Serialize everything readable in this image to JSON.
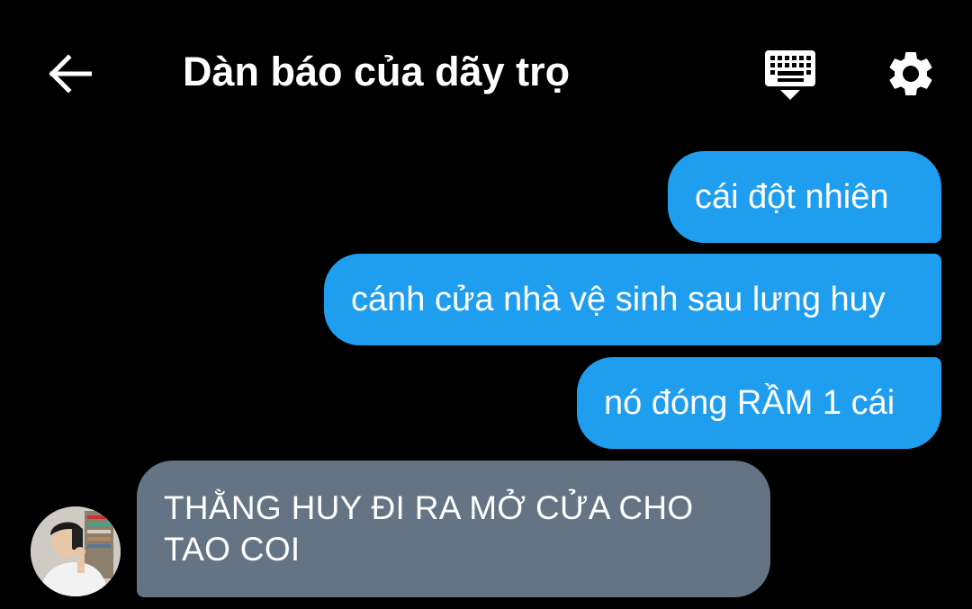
{
  "header": {
    "title": "Dàn báo của dãy trọ",
    "back_icon": "arrow-left-icon",
    "keyboard_icon": "keyboard-hide-icon",
    "settings_icon": "gear-icon"
  },
  "messages": [
    {
      "direction": "outgoing",
      "text": "cái đột nhiên"
    },
    {
      "direction": "outgoing",
      "text": "cánh cửa nhà vệ sinh sau lưng huy"
    },
    {
      "direction": "outgoing",
      "text": "nó đóng RẦM 1 cái"
    },
    {
      "direction": "incoming",
      "text": "THẰNG HUY ĐI RA MỞ CỬA CHO TAO COI"
    }
  ],
  "colors": {
    "background": "#000000",
    "outgoing_bubble": "#1f9ef0",
    "incoming_bubble": "#647484",
    "text": "#ffffff"
  }
}
